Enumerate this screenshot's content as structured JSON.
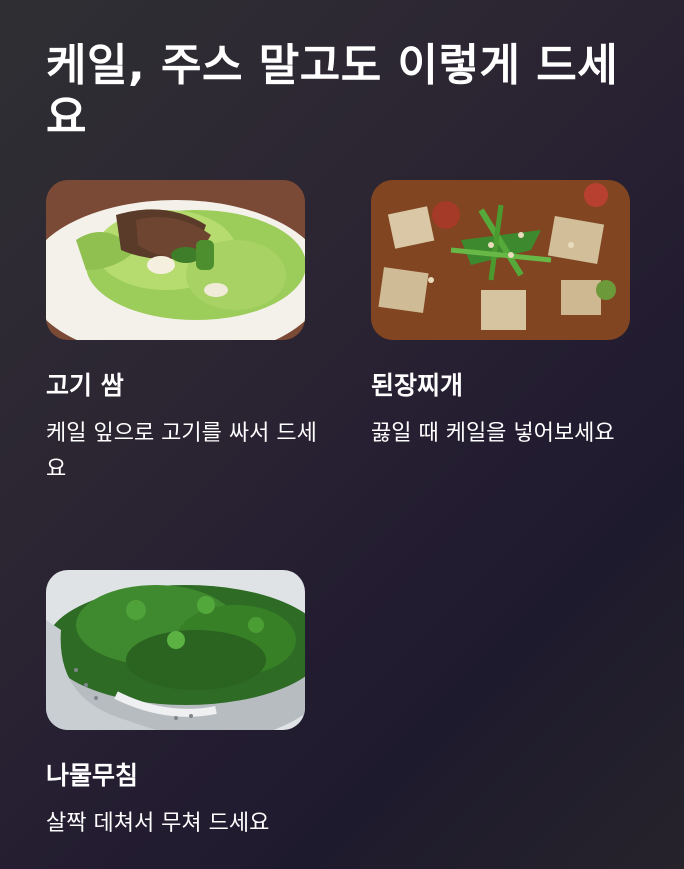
{
  "title": "케일, 주스 말고도 이렇게 드세요",
  "cards": [
    {
      "name": "고기 쌈",
      "desc": "케일 잎으로 고기를 싸서 드세요",
      "image": "meat-wrap-photo"
    },
    {
      "name": "된장찌개",
      "desc": "끓일 때 케일을 넣어보세요",
      "image": "doenjang-stew-photo"
    },
    {
      "name": "나물무침",
      "desc": "살짝 데쳐서 무쳐 드세요",
      "image": "kale-namul-photo"
    }
  ]
}
